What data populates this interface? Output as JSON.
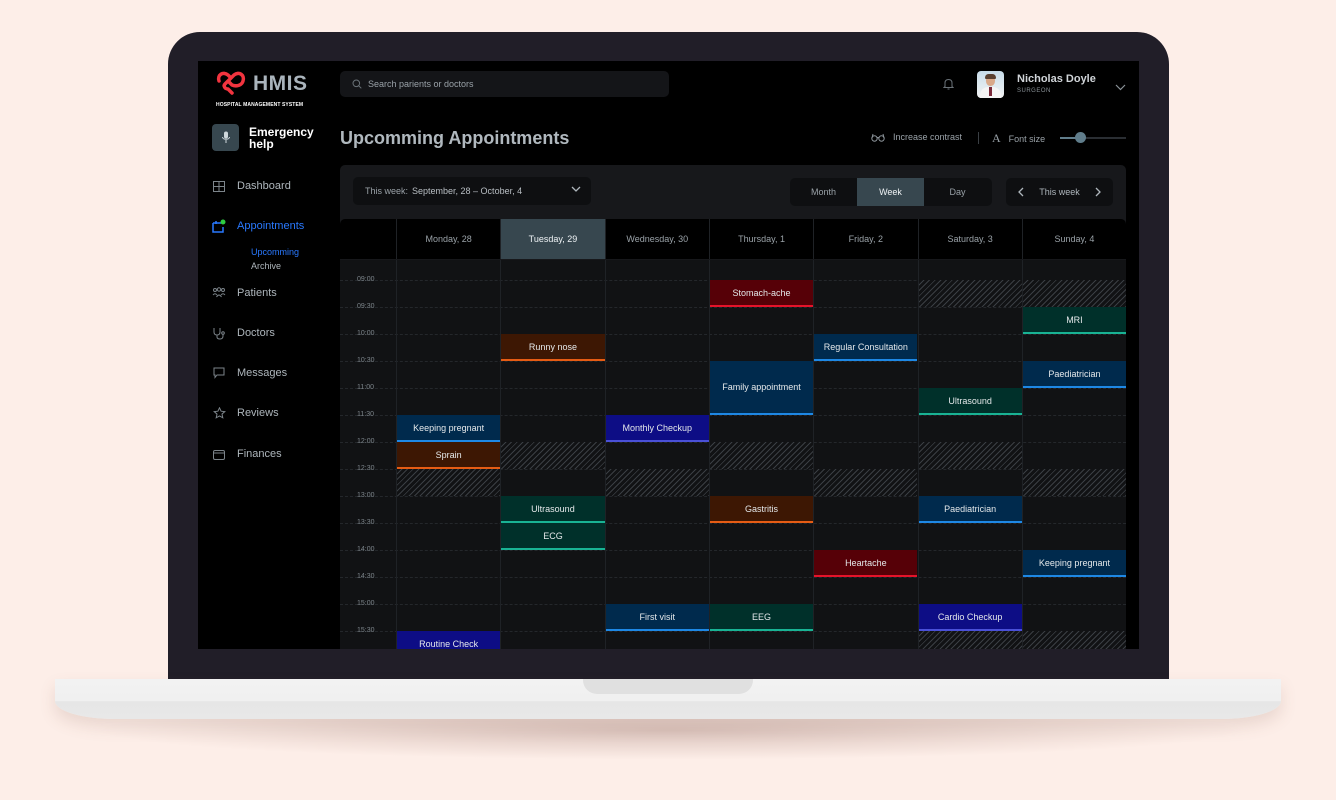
{
  "app": {
    "logo_text": "HMIS",
    "logo_subtitle": "HOSPITAL MANAGEMENT SYSTEM",
    "brand_color": "#f2343f",
    "accent_color": "#2979ff"
  },
  "sidebar": {
    "emergency_label": "Emergency help",
    "items": [
      {
        "label": "Dashboard",
        "icon": "grid-icon"
      },
      {
        "label": "Appointments",
        "icon": "calendar-icon",
        "active": true,
        "badge_color": "#2ecc40"
      },
      {
        "label": "Patients",
        "icon": "users-icon"
      },
      {
        "label": "Doctors",
        "icon": "stethoscope-icon"
      },
      {
        "label": "Messages",
        "icon": "message-icon"
      },
      {
        "label": "Reviews",
        "icon": "star-icon"
      },
      {
        "label": "Finances",
        "icon": "wallet-icon"
      }
    ],
    "subitems": [
      {
        "label": "Upcomming",
        "active": true
      },
      {
        "label": "Archive"
      }
    ]
  },
  "topbar": {
    "search_placeholder": "Search parients or doctors",
    "user_name": "Nicholas Doyle",
    "user_role": "SURGEON"
  },
  "page": {
    "title": "Upcomming Appointments",
    "increase_contrast_label": "Increase contrast",
    "font_size_label": "Font size",
    "font_size_value": 0.3
  },
  "calendar": {
    "week_select_key": "This week:",
    "week_select_value": "September, 28 – October, 4",
    "views": [
      "Month",
      "Week",
      "Day"
    ],
    "active_view": "Week",
    "week_nav_label": "This week",
    "days": [
      "Monday, 28",
      "Tuesday, 29",
      "Wednesday, 30",
      "Thursday, 1",
      "Friday, 2",
      "Saturday, 3",
      "Sunday, 4"
    ],
    "today_index": 1,
    "times": [
      "09:00",
      "09:30",
      "10:00",
      "10:30",
      "11:00",
      "11:30",
      "12:00",
      "12:30",
      "13:00",
      "13:30",
      "14:00",
      "14:30",
      "15:00",
      "15:30"
    ],
    "categories": {
      "orange": {
        "bg": "#3d1703",
        "border": "#e65c14"
      },
      "red": {
        "bg": "#560007",
        "border": "#e5132a"
      },
      "blue": {
        "bg": "#002a4d",
        "border": "#1e88e5"
      },
      "indigo": {
        "bg": "#0d0d85",
        "border": "#4a50d8"
      },
      "teal": {
        "bg": "#00302a",
        "border": "#19b394"
      }
    },
    "blocked": [
      {
        "day": 5,
        "start": "09:00",
        "end": "09:30"
      },
      {
        "day": 6,
        "start": "09:00",
        "end": "09:30"
      },
      {
        "day": 1,
        "start": "12:00",
        "end": "12:30"
      },
      {
        "day": 3,
        "start": "12:00",
        "end": "12:30"
      },
      {
        "day": 5,
        "start": "12:00",
        "end": "12:30"
      },
      {
        "day": 0,
        "start": "12:30",
        "end": "13:00"
      },
      {
        "day": 2,
        "start": "12:30",
        "end": "13:00"
      },
      {
        "day": 4,
        "start": "12:30",
        "end": "13:00"
      },
      {
        "day": 6,
        "start": "12:30",
        "end": "13:00"
      },
      {
        "day": 5,
        "start": "15:30",
        "end": "16:00"
      },
      {
        "day": 6,
        "start": "15:30",
        "end": "16:00"
      }
    ],
    "appointments": [
      {
        "day": 0,
        "start": "11:30",
        "end": "12:00",
        "title": "Keeping pregnant",
        "category": "blue"
      },
      {
        "day": 0,
        "start": "12:00",
        "end": "12:30",
        "title": "Sprain",
        "category": "orange"
      },
      {
        "day": 0,
        "start": "15:30",
        "end": "16:00",
        "title": "Routine Check",
        "category": "indigo"
      },
      {
        "day": 1,
        "start": "10:00",
        "end": "10:30",
        "title": "Runny nose",
        "category": "orange"
      },
      {
        "day": 1,
        "start": "13:00",
        "end": "13:30",
        "title": "Ultrasound",
        "category": "teal"
      },
      {
        "day": 1,
        "start": "13:30",
        "end": "14:00",
        "title": "ECG",
        "category": "teal"
      },
      {
        "day": 2,
        "start": "11:30",
        "end": "12:00",
        "title": "Monthly Checkup",
        "category": "indigo"
      },
      {
        "day": 2,
        "start": "15:00",
        "end": "15:30",
        "title": "First visit",
        "category": "blue"
      },
      {
        "day": 3,
        "start": "09:00",
        "end": "09:30",
        "title": "Stomach-ache",
        "category": "red"
      },
      {
        "day": 3,
        "start": "10:30",
        "end": "11:30",
        "title": "Family appointment",
        "category": "blue"
      },
      {
        "day": 3,
        "start": "13:00",
        "end": "13:30",
        "title": "Gastritis",
        "category": "orange"
      },
      {
        "day": 3,
        "start": "15:00",
        "end": "15:30",
        "title": "EEG",
        "category": "teal"
      },
      {
        "day": 4,
        "start": "10:00",
        "end": "10:30",
        "title": "Regular Consultation",
        "category": "blue"
      },
      {
        "day": 4,
        "start": "14:00",
        "end": "14:30",
        "title": "Heartache",
        "category": "red"
      },
      {
        "day": 5,
        "start": "11:00",
        "end": "11:30",
        "title": "Ultrasound",
        "category": "teal"
      },
      {
        "day": 5,
        "start": "13:00",
        "end": "13:30",
        "title": "Paediatrician",
        "category": "blue"
      },
      {
        "day": 5,
        "start": "15:00",
        "end": "15:30",
        "title": "Cardio Checkup",
        "category": "indigo"
      },
      {
        "day": 6,
        "start": "09:30",
        "end": "10:00",
        "title": "MRI",
        "category": "teal"
      },
      {
        "day": 6,
        "start": "10:30",
        "end": "11:00",
        "title": "Paediatrician",
        "category": "blue"
      },
      {
        "day": 6,
        "start": "14:00",
        "end": "14:30",
        "title": "Keeping pregnant",
        "category": "blue"
      }
    ]
  }
}
